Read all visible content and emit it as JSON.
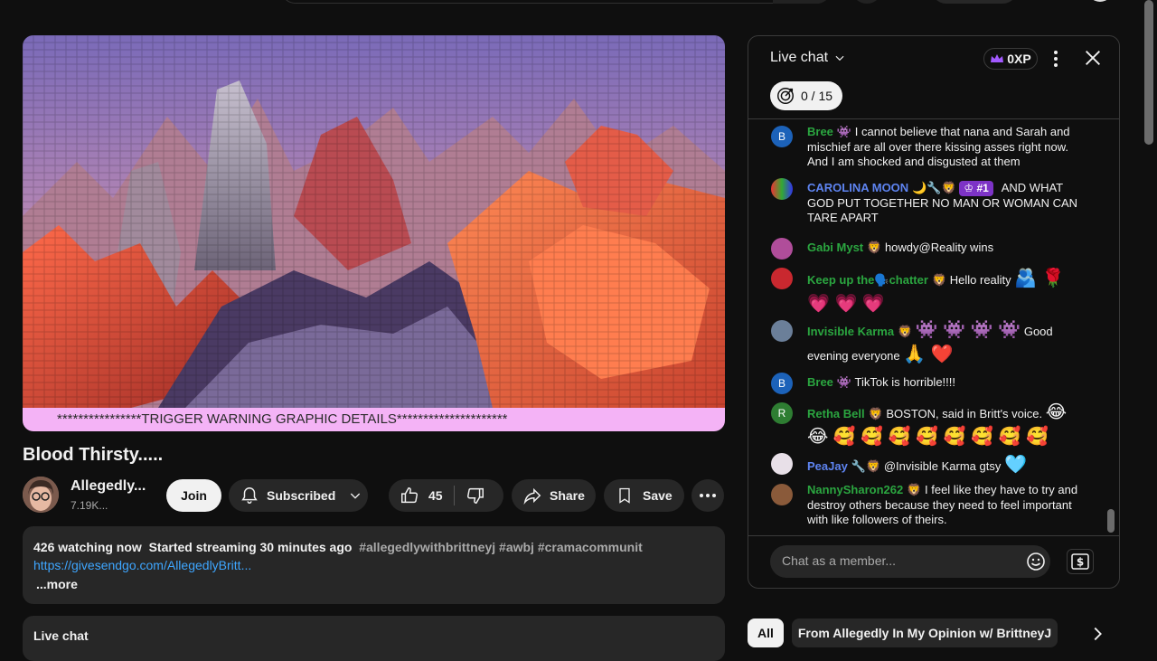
{
  "video": {
    "banner": "****************TRIGGER WARNING GRAPHIC DETAILS*********************",
    "title": "Blood Thirsty....."
  },
  "channel": {
    "name": "Allegedly...",
    "subs": "7.19K..."
  },
  "actions": {
    "join": "Join",
    "subscribed": "Subscribed",
    "likes": "45",
    "share": "Share",
    "save": "Save"
  },
  "description": {
    "watching": "426 watching now",
    "started": "Started streaming 30 minutes ago",
    "tags": "#allegedlywithbrittneyj #awbj #cramacommunit",
    "link": "https://givesendgo.com/AllegedlyBritt...",
    "more": "...more"
  },
  "below_chat_bar": "Live chat",
  "chat": {
    "title": "Live chat",
    "xp": "0XP",
    "goal": "0 / 15",
    "input_placeholder": "Chat as a member...",
    "messages": [
      {
        "author": "Bree",
        "badge": "👾",
        "text": "I cannot believe that nana and Sarah and mischief are all over there kissing asses right now. And I am shocked and disgusted at them",
        "avatar": "B"
      },
      {
        "author": "CAROLINA MOON",
        "badge": "🌙🔧🦁",
        "rank": "#1",
        "text": "AND WHAT GOD PUT TOGETHER NO MAN OR WOMAN CAN TARE APART"
      },
      {
        "author": "Gabi Myst",
        "badge": "🦁",
        "text": "howdy@Reality wins"
      },
      {
        "author": "Keep up the🗣️chatter",
        "badge": "🦁",
        "text": "Hello reality",
        "emojis": "🫂 🌹 💗 💗 💗"
      },
      {
        "author": "Invisible Karma",
        "badge": "🦁",
        "text_pre": "👾 👾 👾 👾",
        "text": "Good evening everyone",
        "emojis": "🙏 ❤️"
      },
      {
        "author": "Bree",
        "badge": "👾",
        "text": "TikTok is horrible!!!!",
        "avatar": "B"
      },
      {
        "author": "Retha Bell",
        "badge": "🦁",
        "text": "BOSTON, said in Britt's voice.",
        "emojis": "😂 😂 🥰 🥰 🥰 🥰 🥰 🥰 🥰 🥰",
        "avatar": "R"
      },
      {
        "author": "PeaJay",
        "badge": "🔧🦁",
        "text": "@Invisible Karma gtsy",
        "emojis": "🩵"
      },
      {
        "author": "NannySharon262",
        "badge": "🦁",
        "text": "I feel like they have to try and destroy others because they need to feel important with like followers of theirs."
      }
    ]
  },
  "chips": {
    "all": "All",
    "from": "From Allegedly In My Opinion w/ BrittneyJ"
  },
  "colors": {
    "background": "#0f0f0f",
    "surface": "#272727",
    "banner": "#f4b3f6",
    "link": "#3ea6ff",
    "author_green": "#2ba640",
    "author_blue": "#5e84f1",
    "rank_badge": "#7d33c6"
  }
}
